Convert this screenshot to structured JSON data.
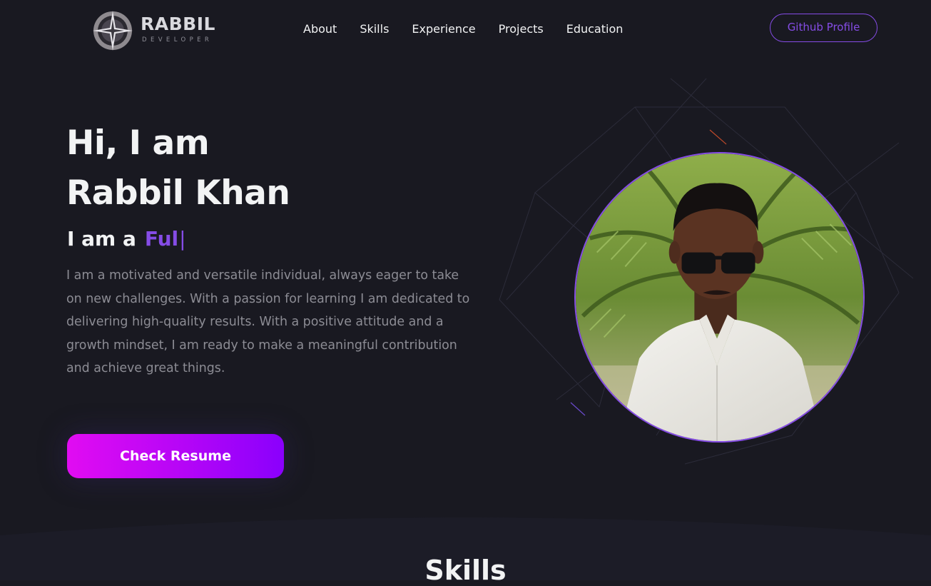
{
  "brand": {
    "title": "RABBIL",
    "subtitle": "DEVELOPER"
  },
  "nav": {
    "links": [
      "About",
      "Skills",
      "Experience",
      "Projects",
      "Education"
    ],
    "github_label": "Github Profile"
  },
  "hero": {
    "greeting": "Hi, I am",
    "name": "Rabbil Khan",
    "role_prefix": "I am a",
    "role_typed": "Ful",
    "role_cursor": "|",
    "description": "I am a motivated and versatile individual, always eager to take on new challenges. With a passion for learning I am dedicated to delivering high-quality results. With a positive attitude and a growth mindset, I am ready to make a meaningful contribution and achieve great things.",
    "resume_label": "Check Resume"
  },
  "skills": {
    "heading": "Skills"
  },
  "colors": {
    "background": "#191921",
    "primary": "#854ce6",
    "text_primary": "#f2f3f4",
    "text_secondary": "#8c8c94",
    "button_gradient_start": "#e10cf2",
    "button_gradient_end": "#8a00fc"
  }
}
